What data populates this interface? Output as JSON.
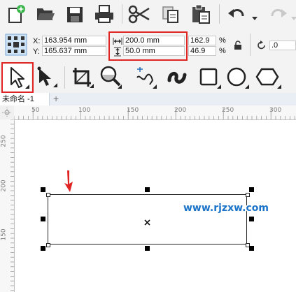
{
  "toolbar": {
    "icons": [
      "new-doc-icon",
      "open-folder-icon",
      "save-icon",
      "print-icon",
      "cut-icon",
      "copy-icon",
      "paste-icon",
      "undo-icon",
      "redo-icon"
    ]
  },
  "properties": {
    "x_label": "X:",
    "x_value": "163.954 mm",
    "y_label": "Y:",
    "y_value": "165.637 mm",
    "width_value": "200.0 mm",
    "height_value": "50.0 mm",
    "scale_x": "162.9",
    "scale_y": "46.9",
    "percent_sign": "%",
    "rotation_value": ".0"
  },
  "document": {
    "tab_label": "未命名 -1",
    "add_tab": "+"
  },
  "ruler": {
    "h_labels": [
      "50",
      "100",
      "150",
      "200",
      "250",
      "300"
    ],
    "v_labels": [
      "250",
      "200",
      "150"
    ]
  },
  "watermark": "www.rjzxw.com",
  "colors": {
    "highlight": "#e02424",
    "watermark_blue": "#1a73c8"
  }
}
